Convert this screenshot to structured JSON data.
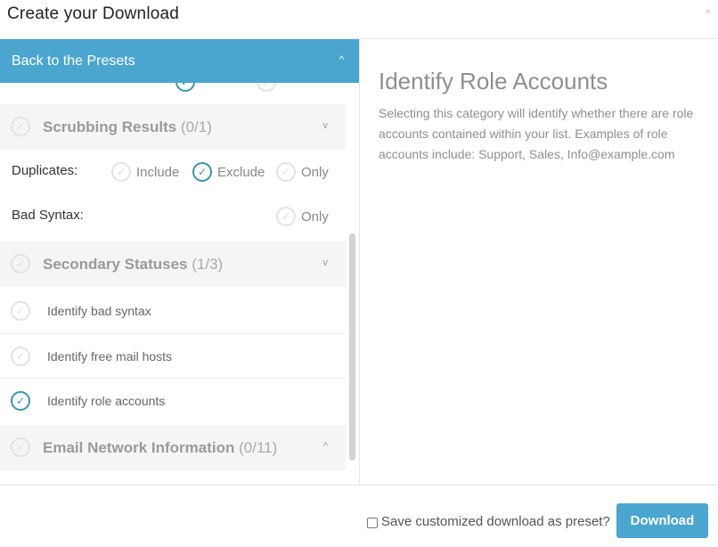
{
  "dialog": {
    "title": "Create your Download",
    "close_icon": "×"
  },
  "presets_bar": {
    "label": "Back to the Presets",
    "chevron": "^"
  },
  "sections": {
    "scrubbing": {
      "name": "Scrubbing Results",
      "count": "(0/1)",
      "chevron": "v",
      "rows": {
        "duplicates": {
          "label": "Duplicates:",
          "options": [
            "Include",
            "Exclude",
            "Only"
          ],
          "selected": "Exclude"
        },
        "bad_syntax": {
          "label": "Bad Syntax:",
          "options": [
            "Only"
          ]
        }
      }
    },
    "secondary": {
      "name": "Secondary Statuses",
      "count": "(1/3)",
      "chevron": "v",
      "items": [
        {
          "label": "Identify bad syntax",
          "checked": false
        },
        {
          "label": "Identify free mail hosts",
          "checked": false
        },
        {
          "label": "Identify role accounts",
          "checked": true
        }
      ]
    },
    "network": {
      "name": "Email Network Information",
      "count": "(0/11)",
      "chevron": "^"
    }
  },
  "detail": {
    "heading": "Identify Role Accounts",
    "description": "Selecting this category will identify whether there are role accounts contained within your list. Examples of role accounts include: Support, Sales, Info@example.com"
  },
  "footer": {
    "preset_label": "Save customized download as preset?",
    "download_label": "Download"
  },
  "icons": {
    "check": "✓"
  },
  "colors": {
    "accent": "#4aa6cf",
    "checked": "#3a94a8"
  }
}
